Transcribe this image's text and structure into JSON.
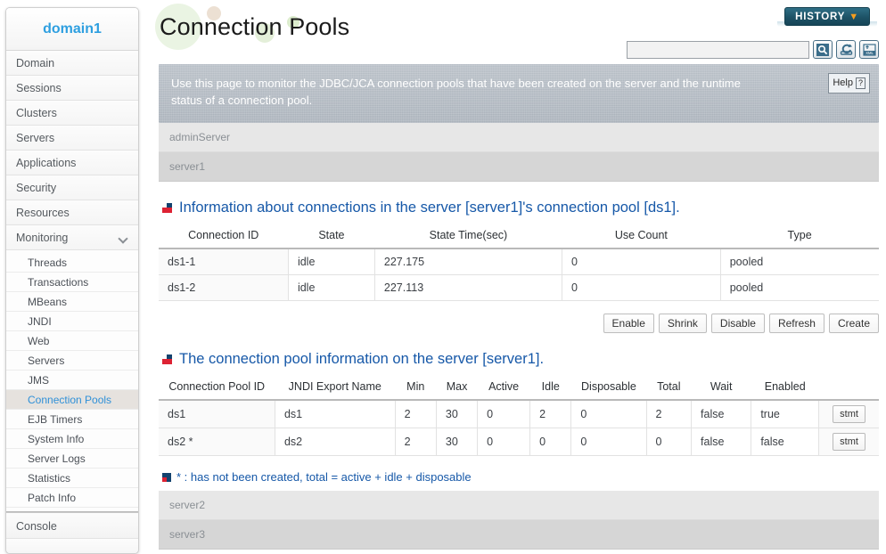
{
  "sidebar": {
    "domain_label": "domain1",
    "items": [
      {
        "label": "Domain",
        "expandable": false
      },
      {
        "label": "Sessions",
        "expandable": false
      },
      {
        "label": "Clusters",
        "expandable": false
      },
      {
        "label": "Servers",
        "expandable": false
      },
      {
        "label": "Applications",
        "expandable": false
      },
      {
        "label": "Security",
        "expandable": false
      },
      {
        "label": "Resources",
        "expandable": false
      },
      {
        "label": "Monitoring",
        "expandable": true
      }
    ],
    "sub_items": [
      {
        "label": "Threads",
        "active": false
      },
      {
        "label": "Transactions",
        "active": false
      },
      {
        "label": "MBeans",
        "active": false
      },
      {
        "label": "JNDI",
        "active": false
      },
      {
        "label": "Web",
        "active": false
      },
      {
        "label": "Servers",
        "active": false
      },
      {
        "label": "JMS",
        "active": false
      },
      {
        "label": "Connection Pools",
        "active": true
      },
      {
        "label": "EJB Timers",
        "active": false
      },
      {
        "label": "System Info",
        "active": false
      },
      {
        "label": "Server Logs",
        "active": false
      },
      {
        "label": "Statistics",
        "active": false
      },
      {
        "label": "Patch Info",
        "active": false
      }
    ],
    "console_label": "Console",
    "accent_color": "#2e9fe0",
    "active_color": "#2f90d8"
  },
  "header": {
    "title": "Connection Pools",
    "history_label": "HISTORY",
    "history_chevron": "▼",
    "history_chevron_color": "#f59e1e",
    "search_value": "",
    "search_placeholder": "",
    "icon_buttons": [
      {
        "name": "search-icon",
        "glyph": "⚲"
      },
      {
        "name": "refresh-icon",
        "glyph": "⟳"
      },
      {
        "name": "xml-export-icon",
        "glyph": "XML"
      }
    ]
  },
  "info": {
    "text": "Use this page to monitor the JDBC/JCA connection pools that have been created on the server and the runtime status of a connection pool.",
    "help_label": "Help",
    "help_glyph": "?"
  },
  "servers_top": [
    {
      "label": "adminServer",
      "shade": "light"
    },
    {
      "label": "server1",
      "shade": "dark"
    }
  ],
  "servers_bottom": [
    {
      "label": "server2",
      "shade": "light"
    },
    {
      "label": "server3",
      "shade": "dark"
    }
  ],
  "section_connections": {
    "heading": "Information about connections in the server [server1]'s connection pool [ds1].",
    "columns": [
      "Connection ID",
      "State",
      "State Time(sec)",
      "Use Count",
      "Type"
    ],
    "rows": [
      [
        "ds1-1",
        "idle",
        "227.175",
        "0",
        "pooled"
      ],
      [
        "ds1-2",
        "idle",
        "227.113",
        "0",
        "pooled"
      ]
    ]
  },
  "action_buttons": [
    "Enable",
    "Shrink",
    "Disable",
    "Refresh",
    "Create"
  ],
  "section_pools": {
    "heading": "The connection pool information on the server [server1].",
    "columns": [
      "Connection Pool ID",
      "JNDI Export Name",
      "Min",
      "Max",
      "Active",
      "Idle",
      "Disposable",
      "Total",
      "Wait",
      "Enabled",
      ""
    ],
    "rows": [
      [
        "ds1",
        "ds1",
        "2",
        "30",
        "0",
        "2",
        "0",
        "2",
        "false",
        "true",
        "stmt"
      ],
      [
        "ds2 *",
        "ds2",
        "2",
        "30",
        "0",
        "0",
        "0",
        "0",
        "false",
        "false",
        "stmt"
      ]
    ]
  },
  "footnote": {
    "text": "* : has not been created, total = active + idle + disposable"
  },
  "colors": {
    "heading_blue": "#1658a8",
    "info_bg": "#aeb6bf",
    "row_light": "#e7e7e7",
    "row_dark": "#d6d6d6"
  }
}
